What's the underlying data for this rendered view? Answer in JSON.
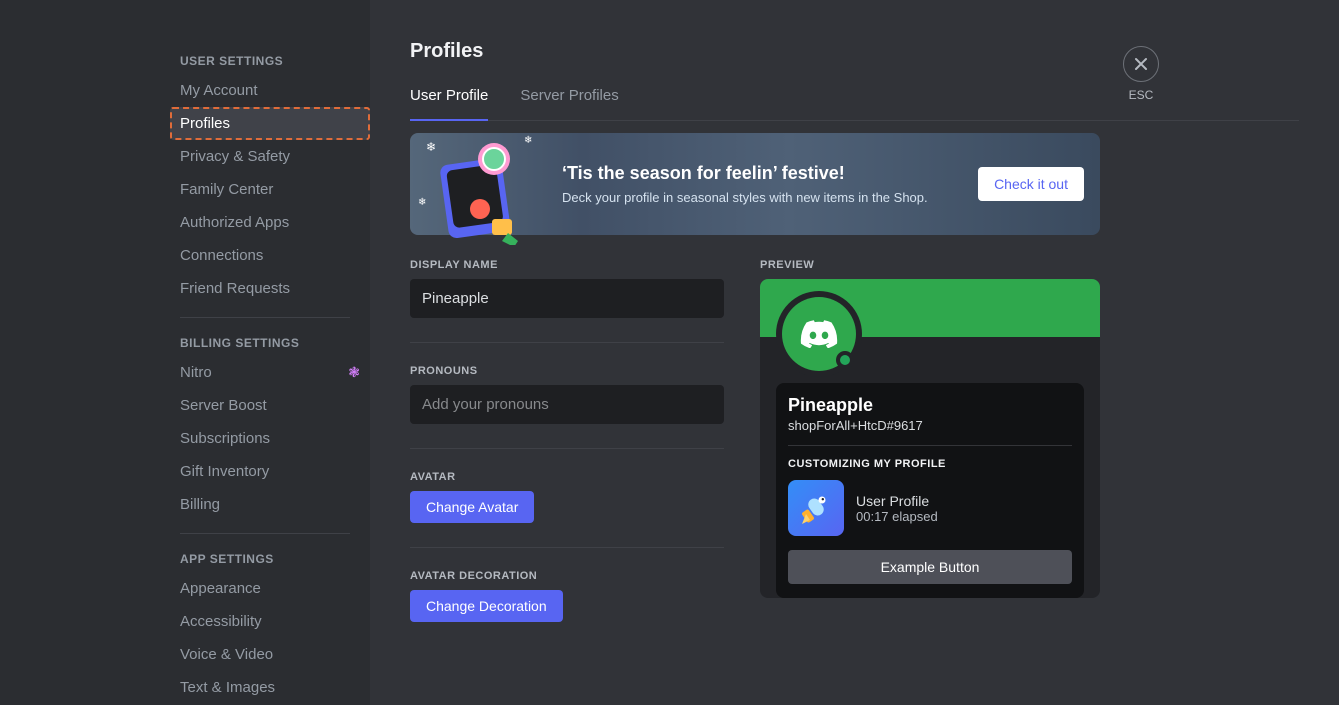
{
  "page": {
    "title": "Profiles"
  },
  "close": {
    "label": "ESC"
  },
  "sidebar": {
    "sections": [
      {
        "heading": "USER SETTINGS",
        "items": [
          {
            "label": "My Account"
          },
          {
            "label": "Profiles",
            "active": true,
            "highlight": true
          },
          {
            "label": "Privacy & Safety"
          },
          {
            "label": "Family Center"
          },
          {
            "label": "Authorized Apps"
          },
          {
            "label": "Connections"
          },
          {
            "label": "Friend Requests"
          }
        ]
      },
      {
        "heading": "BILLING SETTINGS",
        "items": [
          {
            "label": "Nitro",
            "badge": "nitro"
          },
          {
            "label": "Server Boost"
          },
          {
            "label": "Subscriptions"
          },
          {
            "label": "Gift Inventory"
          },
          {
            "label": "Billing"
          }
        ]
      },
      {
        "heading": "APP SETTINGS",
        "items": [
          {
            "label": "Appearance"
          },
          {
            "label": "Accessibility"
          },
          {
            "label": "Voice & Video"
          },
          {
            "label": "Text & Images"
          }
        ]
      }
    ]
  },
  "tabs": [
    {
      "label": "User Profile",
      "active": true
    },
    {
      "label": "Server Profiles"
    }
  ],
  "banner": {
    "title": "‘Tis the season for feelin’ festive!",
    "subtitle": "Deck your profile in seasonal styles with new items in the Shop.",
    "cta": "Check it out"
  },
  "form": {
    "displayName": {
      "label": "DISPLAY NAME",
      "value": "Pineapple"
    },
    "pronouns": {
      "label": "PRONOUNS",
      "placeholder": "Add your pronouns",
      "value": ""
    },
    "avatar": {
      "label": "AVATAR",
      "button": "Change Avatar"
    },
    "avatarDecoration": {
      "label": "AVATAR DECORATION",
      "button": "Change Decoration"
    }
  },
  "preview": {
    "label": "PREVIEW",
    "displayName": "Pineapple",
    "tag": "shopForAll+HtcD#9617",
    "activityHeading": "CUSTOMIZING MY PROFILE",
    "activity": {
      "line1": "User Profile",
      "line2": "00:17 elapsed"
    },
    "exampleButton": "Example Button"
  }
}
